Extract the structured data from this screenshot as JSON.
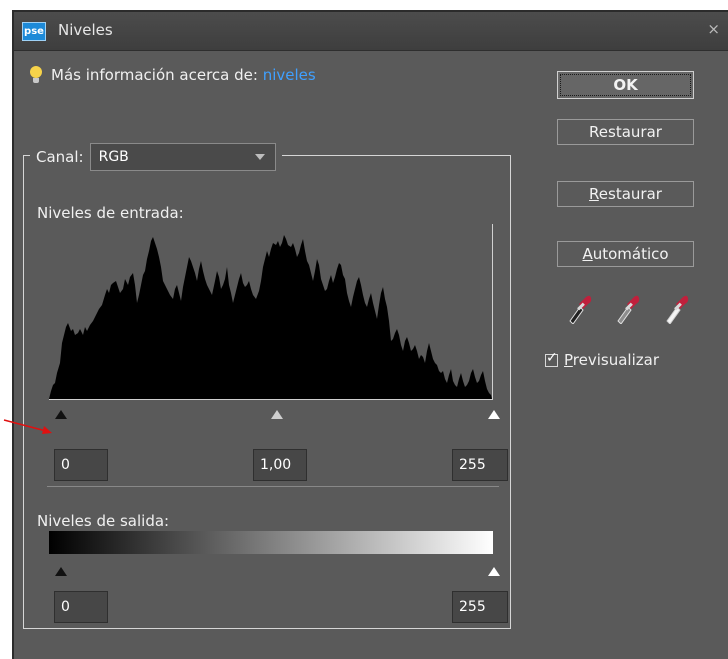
{
  "window": {
    "title": "Niveles",
    "app_badge": "pse",
    "close_glyph": "×"
  },
  "tip": {
    "prefix": "Más información acerca de:",
    "link": "niveles"
  },
  "channel": {
    "label": "Canal:",
    "selected": "RGB"
  },
  "input_levels": {
    "label": "Niveles de entrada:",
    "black": "0",
    "gamma": "1,00",
    "white": "255"
  },
  "output_levels": {
    "label": "Niveles de salida:",
    "black": "0",
    "white": "255"
  },
  "buttons": {
    "ok": "OK",
    "reset1": "Restaurar",
    "reset2_mnemonic": "R",
    "reset2_rest": "estaurar",
    "auto_mnemonic": "A",
    "auto_rest": "utomático"
  },
  "preview": {
    "mnemonic": "P",
    "rest": "revisualizar",
    "checked": true
  },
  "icons": [
    "lightbulb-icon",
    "black-eyedropper-icon",
    "gray-eyedropper-icon",
    "white-eyedropper-icon",
    "close-icon",
    "dropdown-arrow-icon"
  ],
  "colors": {
    "dialog_bg": "#5a5a5a",
    "link": "#3fa0ff",
    "annotation_arrow": "#e01010"
  }
}
